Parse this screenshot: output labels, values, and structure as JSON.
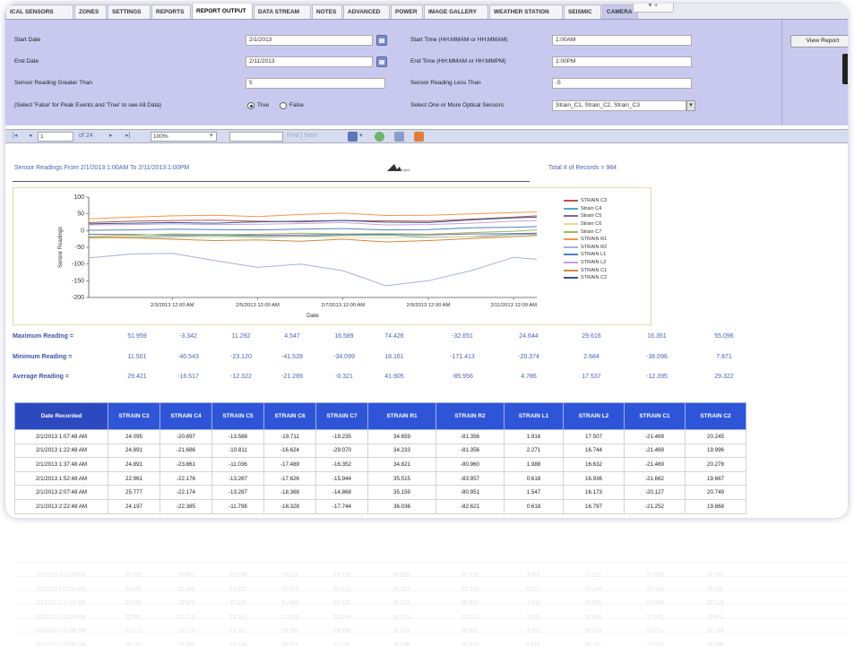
{
  "tabs": [
    {
      "label": "ICAL SENSORS",
      "width": 76
    },
    {
      "label": "ZONES",
      "width": 36
    },
    {
      "label": "SETTINGS",
      "width": 48
    },
    {
      "label": "REPORTS",
      "width": 44
    },
    {
      "label": "REPORT OUTPUT",
      "width": 68,
      "active": true
    },
    {
      "label": "DATA STREAM",
      "width": 64
    },
    {
      "label": "NOTES",
      "width": 34
    },
    {
      "label": "ADVANCED",
      "width": 52
    },
    {
      "label": "POWER",
      "width": 36
    },
    {
      "label": "IMAGE GALLERY",
      "width": 72
    },
    {
      "label": "WEATHER STATION",
      "width": 82
    },
    {
      "label": "SEISMIC",
      "width": 42
    },
    {
      "label": "CAMERA",
      "width": 40,
      "camera": true
    }
  ],
  "tab_extra": "▾  +",
  "params": {
    "start_date_label": "Start Date",
    "start_date_value": "2/1/2013",
    "end_date_label": "End Date",
    "end_date_value": "2/11/2013",
    "greater_label": "Sensor Reading Greater Than",
    "greater_value": "5",
    "peak_label": "(Select 'False' for Peak Events and 'True' to see All Data)",
    "true_label": "True",
    "false_label": "False",
    "start_time_label": "Start Time (HH:MMAM or HH:MMAM)",
    "start_time_value": "1:00AM",
    "end_time_label": "End Time (HH:MMAM or HH:MMPM)",
    "end_time_value": "1:00PM",
    "less_label": "Sensor Reading Less Than",
    "less_value": "-5",
    "sensors_label": "Select One or More Optical Sensors",
    "sensors_value": "Strain_C1, Strain_C2, Strain_C3",
    "view_report": "View Report"
  },
  "toolbar": {
    "first": "|◂",
    "prev": "◂",
    "page": "1",
    "of_pages": "of 24",
    "next": "▸",
    "last": "▸|",
    "zoom": "100%",
    "find_next": "Find | Next"
  },
  "report": {
    "title": "Sensor Readings From 2/1/2013:1:00AM To 2/11/2013:1:00PM",
    "total": "Total # of Records = 984",
    "logo_text": "Dghtr"
  },
  "chart_data": {
    "type": "line",
    "ylabel": "Sensor Readings",
    "xlabel": "Date",
    "ylim": [
      -200,
      100
    ],
    "yticks": [
      100,
      50,
      0,
      -50,
      -100,
      -150,
      -200
    ],
    "xticks": [
      "2/3/2013 12:00 AM",
      "2/5/2013 12:00 AM",
      "2/7/2013 12:00 AM",
      "2/9/2013 12:00 AM",
      "2/11/2013 12:00 AM"
    ],
    "x_domain": [
      "2/1/2013 1:00 AM",
      "2/11/2013 1:00 PM"
    ],
    "x": [
      "2/1/2013 1:00 AM",
      "2/2/2013 1:00 AM",
      "2/3/2013 12:00 AM",
      "2/4/2013 12:00 AM",
      "2/5/2013 12:00 AM",
      "2/6/2013 12:00 AM",
      "2/7/2013 12:00 AM",
      "2/8/2013 12:00 AM",
      "2/9/2013 12:00 AM",
      "2/10/2013 12:00 AM",
      "2/11/2013 12:00 AM",
      "2/11/2013 1:00 PM"
    ],
    "series": [
      {
        "name": "STRAIN C3",
        "color": "#c0504d",
        "values": [
          24,
          28,
          30,
          31,
          28,
          26,
          30,
          29,
          28,
          34,
          40,
          44
        ]
      },
      {
        "name": "Strain C4",
        "color": "#4bacc6",
        "values": [
          -22,
          -19,
          -17,
          -15,
          -18,
          -17,
          -14,
          -13,
          -20,
          -18,
          -12,
          -10
        ]
      },
      {
        "name": "Strain C5",
        "color": "#8064a2",
        "values": [
          -11,
          -12,
          -13,
          -12,
          -14,
          -13,
          -12,
          -11,
          -13,
          -10,
          -9,
          -8
        ]
      },
      {
        "name": "Strain C6",
        "color": "#f0d890",
        "values": [
          -18,
          -20,
          -22,
          -20,
          -21,
          -19,
          -20,
          -22,
          -21,
          -19,
          -18,
          -16
        ]
      },
      {
        "name": "Strain C7",
        "color": "#9bbb59",
        "values": [
          -18,
          -14,
          -10,
          -12,
          -11,
          -8,
          -10,
          -9,
          -11,
          -6,
          -2,
          2
        ]
      },
      {
        "name": "STRAIN R1",
        "color": "#f79646",
        "values": [
          35,
          40,
          44,
          46,
          42,
          48,
          52,
          45,
          46,
          50,
          54,
          56
        ]
      },
      {
        "name": "STRAIN R2",
        "color": "#a6b0e0",
        "values": [
          -82,
          -70,
          -68,
          -90,
          -110,
          -100,
          -120,
          -165,
          -150,
          -120,
          -80,
          -86
        ]
      },
      {
        "name": "STRAIN L1",
        "color": "#4f81bd",
        "values": [
          1,
          2,
          4,
          3,
          2,
          4,
          6,
          2,
          3,
          8,
          10,
          12
        ]
      },
      {
        "name": "STRAIN L2",
        "color": "#c9a0dc",
        "values": [
          17,
          18,
          20,
          18,
          19,
          21,
          24,
          17,
          18,
          22,
          28,
          30
        ]
      },
      {
        "name": "STRAIN C1",
        "color": "#d4883a",
        "values": [
          -21,
          -22,
          -26,
          -30,
          -28,
          -32,
          -26,
          -34,
          -30,
          -24,
          -18,
          -14
        ]
      },
      {
        "name": "STRAIN C2",
        "color": "#2f5597",
        "values": [
          20,
          22,
          24,
          22,
          26,
          28,
          30,
          25,
          24,
          32,
          38,
          40
        ]
      }
    ]
  },
  "stats": {
    "max_label": "Maximum Reading =",
    "min_label": "Minimum Reading =",
    "avg_label": "Average Reading =",
    "max": [
      "51.959",
      "-3.342",
      "11.292",
      "4.547",
      "16.589",
      "74.426",
      "-32.651",
      "24.644",
      "29.616",
      "16.351",
      "55.096"
    ],
    "min": [
      "11.501",
      "-40.543",
      "-23.120",
      "-41.528",
      "-34.099",
      "18.161",
      "-171.413",
      "-20.374",
      "2.684",
      "-36.096",
      "7.871"
    ],
    "avg": [
      "29.421",
      "-16.517",
      "-12.322",
      "-21.289",
      "-0.321",
      "41.905",
      "-85.956",
      "4.786",
      "17.537",
      "-12.395",
      "29.322"
    ]
  },
  "table": {
    "headers": [
      "Date Recorded",
      "STRAIN C3",
      "STRAIN C4",
      "STRAIN C5",
      "STRAIN C6",
      "STRAIN C7",
      "STRAIN R1",
      "STRAIN R2",
      "STRAIN L1",
      "STRAIN L2",
      "STRAIN C1",
      "STRAIN C2"
    ],
    "rows": [
      [
        "2/1/2013 1:07:48 AM",
        "24.095",
        "-20.897",
        "-13.588",
        "-19.711",
        "-19.235",
        "34.659",
        "-81.356",
        "1.916",
        "17.507",
        "-21.469",
        "20.245"
      ],
      [
        "2/1/2013 1:22:48 AM",
        "24.891",
        "-21.686",
        "-10.811",
        "-16.624",
        "-29.070",
        "34.233",
        "-81.356",
        "2.271",
        "16.744",
        "-21.469",
        "19.996"
      ],
      [
        "2/1/2013 1:37:48 AM",
        "24.891",
        "-23.861",
        "-11.036",
        "-17.489",
        "-16.352",
        "34.821",
        "-80.960",
        "1.988",
        "16.632",
        "-21.469",
        "20.278"
      ],
      [
        "2/1/2013 1:52:48 AM",
        "22.961",
        "-22.176",
        "-13.267",
        "-17.626",
        "-15.944",
        "35.515",
        "-83.957",
        "0.618",
        "16.936",
        "-21.662",
        "19.667"
      ],
      [
        "2/1/2013 2:07:48 AM",
        "25.777",
        "-22.174",
        "-13.287",
        "-18.368",
        "-14.868",
        "35.159",
        "-80.951",
        "1.547",
        "16.173",
        "-20.127",
        "20.749"
      ],
      [
        "2/1/2013 2:22:48 AM",
        "24.197",
        "-22.385",
        "-11.798",
        "-18.328",
        "-17.744",
        "36.036",
        "-82.621",
        "0.618",
        "16.797",
        "-21.252",
        "19.868"
      ]
    ]
  },
  "colors": {
    "panel": "#c9c9f0",
    "table_header": "#2e55d8",
    "stat_text": "#4b63b7"
  }
}
